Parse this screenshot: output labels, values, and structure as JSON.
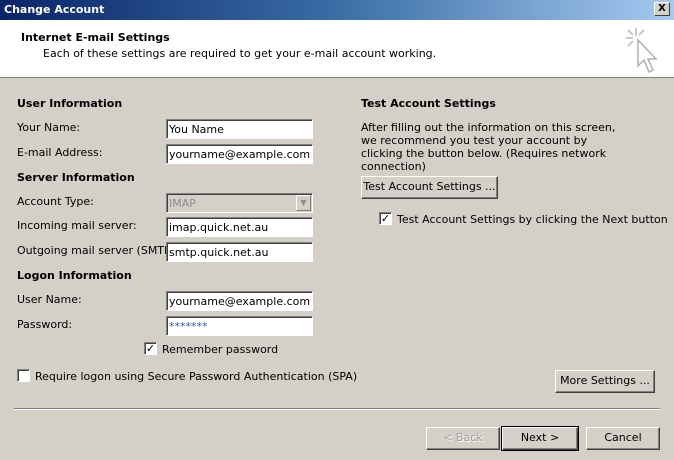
{
  "window": {
    "title": "Change Account",
    "close_label": "X"
  },
  "header": {
    "title": "Internet E-mail Settings",
    "subtitle": "Each of these settings are required to get your e-mail account working."
  },
  "user_info": {
    "heading": "User Information",
    "name_label": "Your Name:",
    "name_value": "You Name",
    "email_label": "E-mail Address:",
    "email_value": "yourname@example.com"
  },
  "server_info": {
    "heading": "Server Information",
    "type_label": "Account Type:",
    "type_value": "IMAP",
    "incoming_label": "Incoming mail server:",
    "incoming_value": "imap.quick.net.au",
    "outgoing_label": "Outgoing mail server (SMTP):",
    "outgoing_value": "smtp.quick.net.au"
  },
  "logon_info": {
    "heading": "Logon Information",
    "user_label": "User Name:",
    "user_value": "yourname@example.com",
    "password_label": "Password:",
    "password_value": "*******",
    "remember_label": "Remember password",
    "remember_checked": true,
    "spa_label": "Require logon using Secure Password Authentication (SPA)",
    "spa_checked": false
  },
  "test": {
    "heading": "Test Account Settings",
    "description": "After filling out the information on this screen, we recommend you test your account by clicking the button below. (Requires network connection)",
    "button": "Test Account Settings ...",
    "next_label": "Test Account Settings by clicking the Next button",
    "next_checked": true
  },
  "buttons": {
    "more": "More Settings ...",
    "back": "< Back",
    "next": "Next >",
    "cancel": "Cancel"
  }
}
